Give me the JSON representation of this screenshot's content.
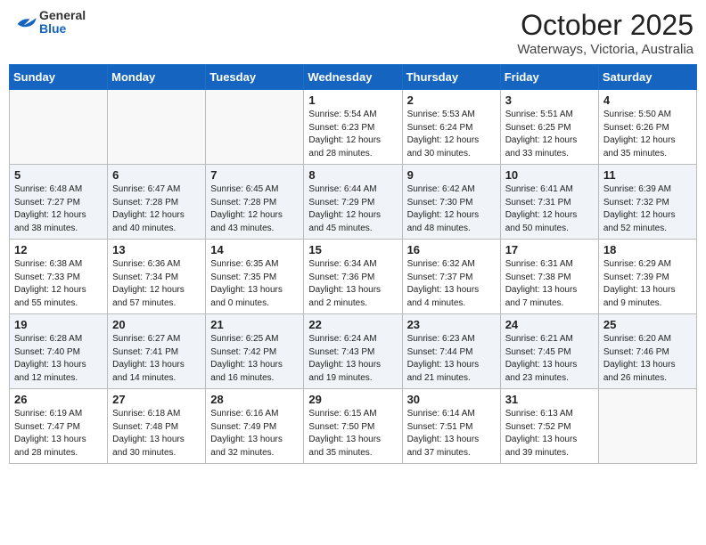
{
  "header": {
    "logo_general": "General",
    "logo_blue": "Blue",
    "month_title": "October 2025",
    "location": "Waterways, Victoria, Australia"
  },
  "weekdays": [
    "Sunday",
    "Monday",
    "Tuesday",
    "Wednesday",
    "Thursday",
    "Friday",
    "Saturday"
  ],
  "weeks": [
    [
      {
        "day": "",
        "info": ""
      },
      {
        "day": "",
        "info": ""
      },
      {
        "day": "",
        "info": ""
      },
      {
        "day": "1",
        "info": "Sunrise: 5:54 AM\nSunset: 6:23 PM\nDaylight: 12 hours\nand 28 minutes."
      },
      {
        "day": "2",
        "info": "Sunrise: 5:53 AM\nSunset: 6:24 PM\nDaylight: 12 hours\nand 30 minutes."
      },
      {
        "day": "3",
        "info": "Sunrise: 5:51 AM\nSunset: 6:25 PM\nDaylight: 12 hours\nand 33 minutes."
      },
      {
        "day": "4",
        "info": "Sunrise: 5:50 AM\nSunset: 6:26 PM\nDaylight: 12 hours\nand 35 minutes."
      }
    ],
    [
      {
        "day": "5",
        "info": "Sunrise: 6:48 AM\nSunset: 7:27 PM\nDaylight: 12 hours\nand 38 minutes."
      },
      {
        "day": "6",
        "info": "Sunrise: 6:47 AM\nSunset: 7:28 PM\nDaylight: 12 hours\nand 40 minutes."
      },
      {
        "day": "7",
        "info": "Sunrise: 6:45 AM\nSunset: 7:28 PM\nDaylight: 12 hours\nand 43 minutes."
      },
      {
        "day": "8",
        "info": "Sunrise: 6:44 AM\nSunset: 7:29 PM\nDaylight: 12 hours\nand 45 minutes."
      },
      {
        "day": "9",
        "info": "Sunrise: 6:42 AM\nSunset: 7:30 PM\nDaylight: 12 hours\nand 48 minutes."
      },
      {
        "day": "10",
        "info": "Sunrise: 6:41 AM\nSunset: 7:31 PM\nDaylight: 12 hours\nand 50 minutes."
      },
      {
        "day": "11",
        "info": "Sunrise: 6:39 AM\nSunset: 7:32 PM\nDaylight: 12 hours\nand 52 minutes."
      }
    ],
    [
      {
        "day": "12",
        "info": "Sunrise: 6:38 AM\nSunset: 7:33 PM\nDaylight: 12 hours\nand 55 minutes."
      },
      {
        "day": "13",
        "info": "Sunrise: 6:36 AM\nSunset: 7:34 PM\nDaylight: 12 hours\nand 57 minutes."
      },
      {
        "day": "14",
        "info": "Sunrise: 6:35 AM\nSunset: 7:35 PM\nDaylight: 13 hours\nand 0 minutes."
      },
      {
        "day": "15",
        "info": "Sunrise: 6:34 AM\nSunset: 7:36 PM\nDaylight: 13 hours\nand 2 minutes."
      },
      {
        "day": "16",
        "info": "Sunrise: 6:32 AM\nSunset: 7:37 PM\nDaylight: 13 hours\nand 4 minutes."
      },
      {
        "day": "17",
        "info": "Sunrise: 6:31 AM\nSunset: 7:38 PM\nDaylight: 13 hours\nand 7 minutes."
      },
      {
        "day": "18",
        "info": "Sunrise: 6:29 AM\nSunset: 7:39 PM\nDaylight: 13 hours\nand 9 minutes."
      }
    ],
    [
      {
        "day": "19",
        "info": "Sunrise: 6:28 AM\nSunset: 7:40 PM\nDaylight: 13 hours\nand 12 minutes."
      },
      {
        "day": "20",
        "info": "Sunrise: 6:27 AM\nSunset: 7:41 PM\nDaylight: 13 hours\nand 14 minutes."
      },
      {
        "day": "21",
        "info": "Sunrise: 6:25 AM\nSunset: 7:42 PM\nDaylight: 13 hours\nand 16 minutes."
      },
      {
        "day": "22",
        "info": "Sunrise: 6:24 AM\nSunset: 7:43 PM\nDaylight: 13 hours\nand 19 minutes."
      },
      {
        "day": "23",
        "info": "Sunrise: 6:23 AM\nSunset: 7:44 PM\nDaylight: 13 hours\nand 21 minutes."
      },
      {
        "day": "24",
        "info": "Sunrise: 6:21 AM\nSunset: 7:45 PM\nDaylight: 13 hours\nand 23 minutes."
      },
      {
        "day": "25",
        "info": "Sunrise: 6:20 AM\nSunset: 7:46 PM\nDaylight: 13 hours\nand 26 minutes."
      }
    ],
    [
      {
        "day": "26",
        "info": "Sunrise: 6:19 AM\nSunset: 7:47 PM\nDaylight: 13 hours\nand 28 minutes."
      },
      {
        "day": "27",
        "info": "Sunrise: 6:18 AM\nSunset: 7:48 PM\nDaylight: 13 hours\nand 30 minutes."
      },
      {
        "day": "28",
        "info": "Sunrise: 6:16 AM\nSunset: 7:49 PM\nDaylight: 13 hours\nand 32 minutes."
      },
      {
        "day": "29",
        "info": "Sunrise: 6:15 AM\nSunset: 7:50 PM\nDaylight: 13 hours\nand 35 minutes."
      },
      {
        "day": "30",
        "info": "Sunrise: 6:14 AM\nSunset: 7:51 PM\nDaylight: 13 hours\nand 37 minutes."
      },
      {
        "day": "31",
        "info": "Sunrise: 6:13 AM\nSunset: 7:52 PM\nDaylight: 13 hours\nand 39 minutes."
      },
      {
        "day": "",
        "info": ""
      }
    ]
  ]
}
